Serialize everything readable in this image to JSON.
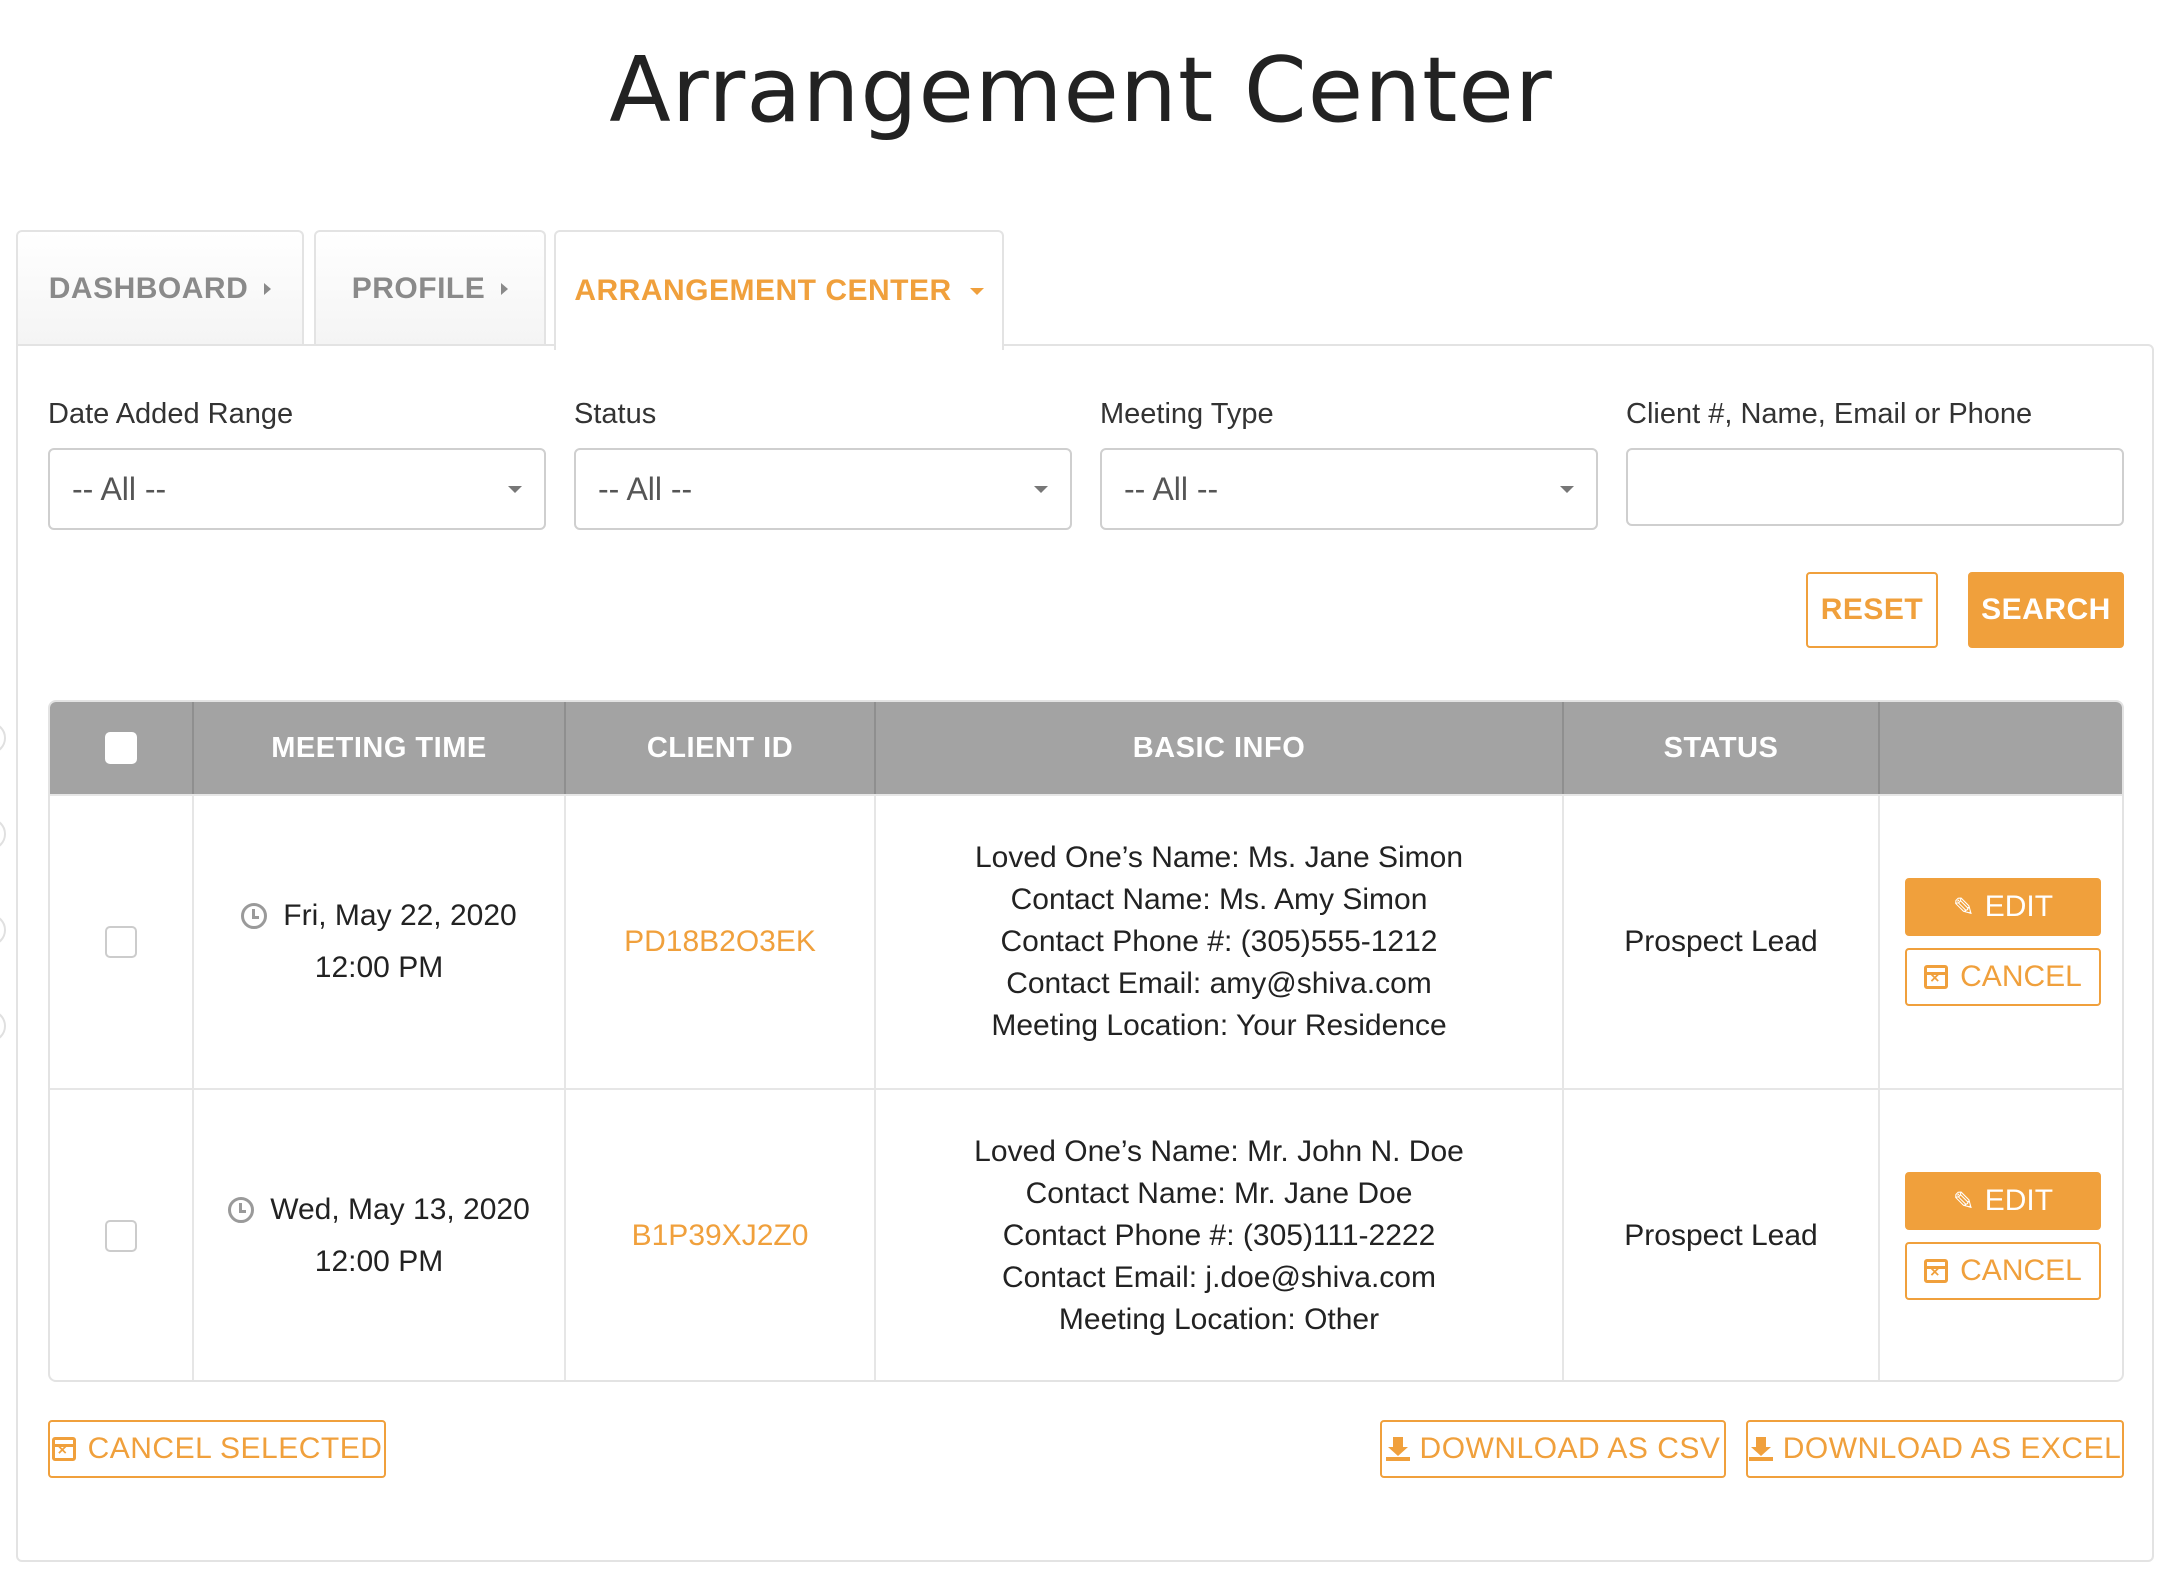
{
  "page": {
    "title": "Arrangement Center"
  },
  "tabs": [
    {
      "label": "DASHBOARD",
      "active": false
    },
    {
      "label": "PROFILE",
      "active": false
    },
    {
      "label": "ARRANGEMENT CENTER",
      "active": true
    }
  ],
  "filters": {
    "date_range": {
      "label": "Date Added Range",
      "value": "-- All --"
    },
    "status": {
      "label": "Status",
      "value": "-- All --"
    },
    "meeting_type": {
      "label": "Meeting Type",
      "value": "-- All --"
    },
    "search": {
      "label": "Client #, Name, Email or Phone",
      "value": "",
      "placeholder": ""
    }
  },
  "buttons": {
    "reset": "RESET",
    "search": "SEARCH"
  },
  "table": {
    "headers": [
      "MEETING TIME",
      "CLIENT ID",
      "BASIC INFO",
      "STATUS"
    ],
    "rows": [
      {
        "date": "Fri, May 22, 2020",
        "time": "12:00 PM",
        "client_id": "PD18B2O3EK",
        "info": [
          "Loved One’s Name: Ms. Jane Simon",
          "Contact Name: Ms. Amy Simon",
          "Contact Phone #: (305)555-1212",
          "Contact Email: amy@shiva.com",
          "Meeting Location: Your Residence"
        ],
        "status": "Prospect Lead",
        "edit": "EDIT",
        "cancel": "CANCEL"
      },
      {
        "date": "Wed, May 13, 2020",
        "time": "12:00 PM",
        "client_id": "B1P39XJ2Z0",
        "info": [
          "Loved One’s Name: Mr. John N. Doe",
          "Contact Name: Mr. Jane Doe",
          "Contact Phone #: (305)111-2222",
          "Contact Email: j.doe@shiva.com",
          "Meeting Location: Other"
        ],
        "status": "Prospect Lead",
        "edit": "EDIT",
        "cancel": "CANCEL"
      }
    ]
  },
  "footer": {
    "cancel_selected": "CANCEL SELECTED",
    "download_csv": "DOWNLOAD AS CSV",
    "download_excel": "DOWNLOAD AS EXCEL"
  },
  "colors": {
    "accent": "#f0a03c",
    "header_bg": "#a3a3a3",
    "tab_inactive_text": "#8a8a8a"
  },
  "icons": [
    "caret-right-icon",
    "caret-down-icon",
    "clock-icon",
    "pencil-icon",
    "calendar-cancel-icon",
    "download-icon"
  ]
}
